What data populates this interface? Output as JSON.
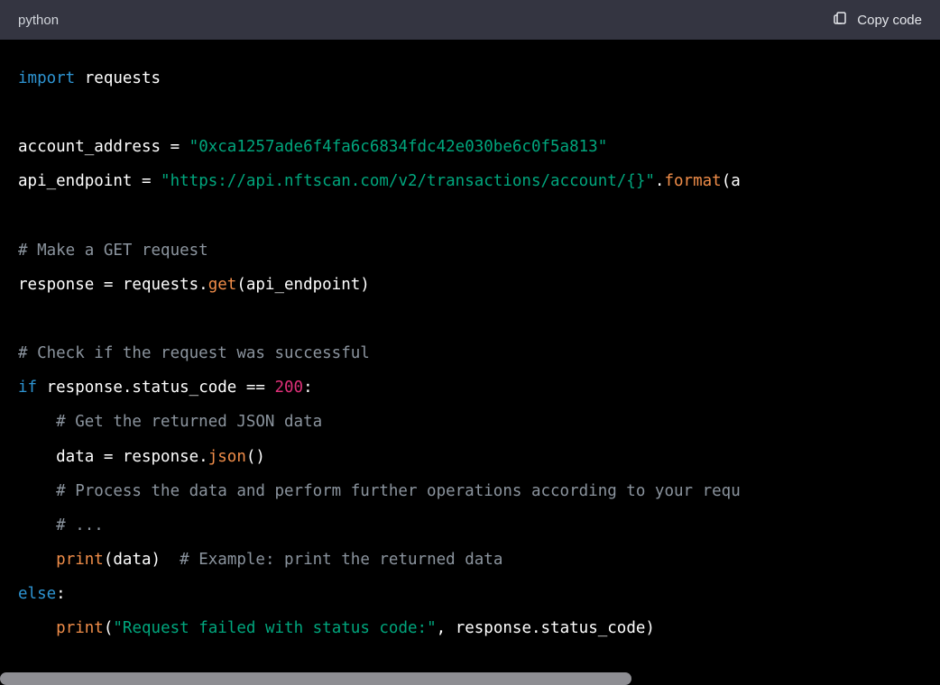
{
  "header": {
    "language_label": "python",
    "copy_label": "Copy code"
  },
  "code": {
    "l1_kw_import": "import",
    "l1_requests": " requests",
    "l3_assign": "account_address = ",
    "l3_str": "\"0xca1257ade6f4fa6c6834fdc42e030be6c0f5a813\"",
    "l4_assign": "api_endpoint = ",
    "l4_str": "\"https://api.nftscan.com/v2/transactions/account/{}\"",
    "l4_dot": ".",
    "l4_format": "format",
    "l4_tail": "(a",
    "l6_com": "# Make a GET request",
    "l7_prefix": "response = requests.",
    "l7_get": "get",
    "l7_args": "(api_endpoint)",
    "l9_com": "# Check if the request was successful",
    "l10_if": "if",
    "l10_cond": " response.status_code == ",
    "l10_num": "200",
    "l10_colon": ":",
    "l11_com": "    # Get the returned JSON data",
    "l12_prefix": "    data = response.",
    "l12_json": "json",
    "l12_tail": "()",
    "l13_com": "    # Process the data and perform further operations according to your requ",
    "l14_com": "    # ...",
    "l15_indent": "    ",
    "l15_print": "print",
    "l15_args": "(data)",
    "l15_com": "  # Example: print the returned data",
    "l16_else": "else",
    "l16_colon": ":",
    "l17_indent": "    ",
    "l17_print": "print",
    "l17_open": "(",
    "l17_str": "\"Request failed with status code:\"",
    "l17_tail": ", response.status_code)"
  }
}
